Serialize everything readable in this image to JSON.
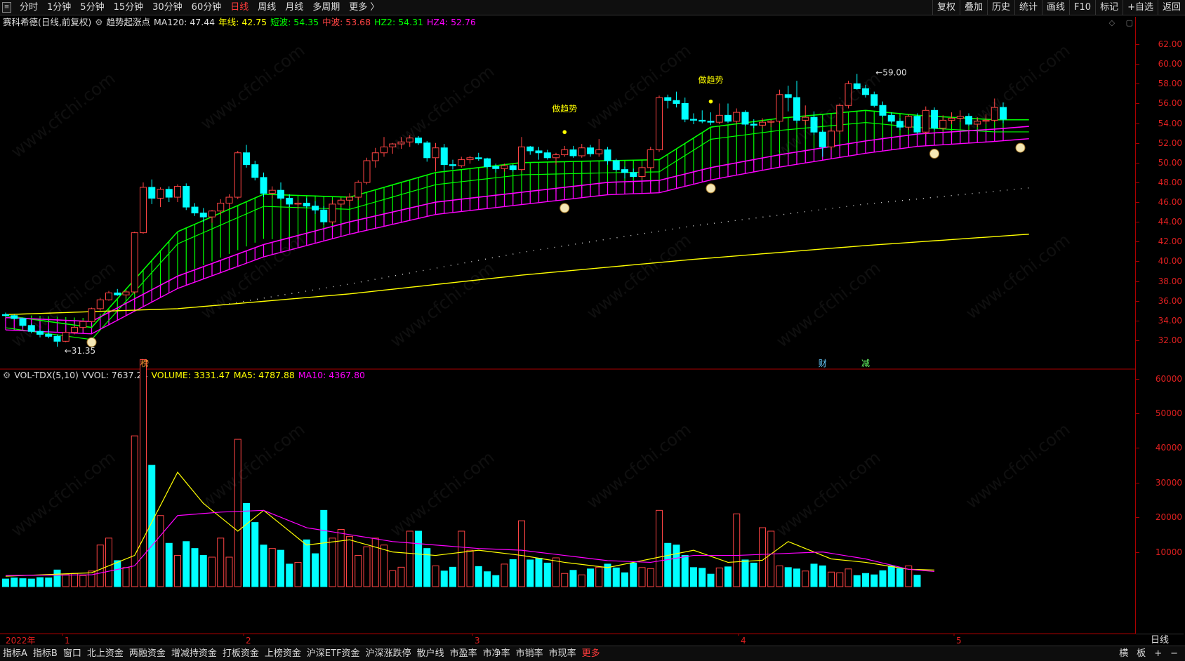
{
  "top_toolbar": {
    "left_items": [
      "分时",
      "1分钟",
      "5分钟",
      "15分钟",
      "30分钟",
      "60分钟",
      "日线",
      "周线",
      "月线",
      "多周期",
      "更多 〉"
    ],
    "active": "日线",
    "right_items": [
      "复权",
      "叠加",
      "历史",
      "统计",
      "画线",
      "F10",
      "标记",
      "+自选",
      "返回"
    ]
  },
  "main_info": {
    "title": "赛科希德(日线,前复权)",
    "indicator": "趋势起涨点",
    "ma120": "MA120: 47.44",
    "nianxian": "年线: 42.75",
    "duanbo": "短波: 54.35",
    "zhongbo": "中波: 53.68",
    "hz2": "HZ2: 54.31",
    "hz4": "HZ4: 52.76"
  },
  "vol_info": {
    "title": "VOL-TDX(5,10)",
    "vvol": "VVOL: 7637.24",
    "volume": "VOLUME: 3331.47",
    "ma5": "MA5: 4787.88",
    "ma10": "MA10: 4367.80"
  },
  "annotations": {
    "low": "←31.35",
    "high": "←59.00",
    "signal1": "做趋势",
    "signal2": "做趋势",
    "tag_bang": "榜",
    "tag_cai": "财",
    "tag_jian": "减"
  },
  "dates": [
    "2022年",
    "1",
    "2",
    "3",
    "4",
    "5"
  ],
  "period_label": "日线",
  "bottom_tabs": [
    "指标A",
    "指标B",
    "窗口",
    "北上资金",
    "两融资金",
    "增减持资金",
    "打板资金",
    "上榜资金",
    "沪深ETF资金",
    "沪深涨跌停",
    "散户线",
    "市盈率",
    "市净率",
    "市销率",
    "市现率",
    "更多"
  ],
  "bottom_right": [
    "横",
    "板",
    "+",
    "−"
  ],
  "colors": {
    "up": "#ff4444",
    "down": "#00ffff",
    "green_band": "#00ff00",
    "magenta_band": "#ff00ff",
    "yellow_line": "#ffff00",
    "axis": "#e02020"
  },
  "watermark": "www.cfchi.com",
  "chart_data": [
    {
      "type": "candlestick",
      "title": "赛科希德(日线,前复权)",
      "ylim": [
        30.5,
        63.5
      ],
      "yticks": [
        32.0,
        34.0,
        36.0,
        38.0,
        40.0,
        42.0,
        44.0,
        46.0,
        48.0,
        50.0,
        52.0,
        54.0,
        56.0,
        58.0,
        60.0,
        62.0
      ],
      "ohlc": [
        [
          34.6,
          34.8,
          34.4,
          34.5
        ],
        [
          34.5,
          34.6,
          34.1,
          34.2
        ],
        [
          34.2,
          34.3,
          33.3,
          33.5
        ],
        [
          33.5,
          33.7,
          32.7,
          32.9
        ],
        [
          32.9,
          33.1,
          32.3,
          32.6
        ],
        [
          32.6,
          33.1,
          32.2,
          32.4
        ],
        [
          32.4,
          32.6,
          31.35,
          31.9
        ],
        [
          31.9,
          33.0,
          31.8,
          32.8
        ],
        [
          32.8,
          33.5,
          32.6,
          33.3
        ],
        [
          33.3,
          34.0,
          33.0,
          33.9
        ],
        [
          33.9,
          35.3,
          33.8,
          35.2
        ],
        [
          35.2,
          36.3,
          35.0,
          36.1
        ],
        [
          36.1,
          37.0,
          36.0,
          36.8
        ],
        [
          36.8,
          37.2,
          36.5,
          36.6
        ],
        [
          36.6,
          37.1,
          36.3,
          36.9
        ],
        [
          36.9,
          43.0,
          36.7,
          42.9
        ],
        [
          42.9,
          48.0,
          42.8,
          47.5
        ],
        [
          47.5,
          48.3,
          45.8,
          46.4
        ],
        [
          46.4,
          47.5,
          45.5,
          47.3
        ],
        [
          47.3,
          47.6,
          46.0,
          46.5
        ],
        [
          46.5,
          47.8,
          46.0,
          47.6
        ],
        [
          47.6,
          47.9,
          45.2,
          45.5
        ],
        [
          45.5,
          45.9,
          44.6,
          44.9
        ],
        [
          44.9,
          45.4,
          44.0,
          44.5
        ],
        [
          44.5,
          45.2,
          43.9,
          45.1
        ],
        [
          45.1,
          46.3,
          44.7,
          45.9
        ],
        [
          45.9,
          46.8,
          45.3,
          46.5
        ],
        [
          46.5,
          51.2,
          46.3,
          51.0
        ],
        [
          51.0,
          51.8,
          49.5,
          49.8
        ],
        [
          49.8,
          50.2,
          48.2,
          48.5
        ],
        [
          48.5,
          49.0,
          46.5,
          46.9
        ],
        [
          46.9,
          47.6,
          46.4,
          47.2
        ],
        [
          47.2,
          48.0,
          46.2,
          46.4
        ],
        [
          46.4,
          46.8,
          45.5,
          45.8
        ],
        [
          45.8,
          46.2,
          45.3,
          45.9
        ],
        [
          45.9,
          46.4,
          45.4,
          45.6
        ],
        [
          45.6,
          46.1,
          44.8,
          45.2
        ],
        [
          45.2,
          45.6,
          43.7,
          44.0
        ],
        [
          44.0,
          46.2,
          43.8,
          45.8
        ],
        [
          45.8,
          46.4,
          45.5,
          46.2
        ],
        [
          46.2,
          46.9,
          45.6,
          46.5
        ],
        [
          46.5,
          48.2,
          46.2,
          48.0
        ],
        [
          48.0,
          50.5,
          47.8,
          50.2
        ],
        [
          50.2,
          51.5,
          49.5,
          51.0
        ],
        [
          51.0,
          52.6,
          50.6,
          51.6
        ],
        [
          51.6,
          52.0,
          50.9,
          51.9
        ],
        [
          51.9,
          52.6,
          51.4,
          52.1
        ],
        [
          52.1,
          52.8,
          51.6,
          52.5
        ],
        [
          52.5,
          52.7,
          51.8,
          52.0
        ],
        [
          52.0,
          52.2,
          50.1,
          50.5
        ],
        [
          50.5,
          52.0,
          49.1,
          51.5
        ],
        [
          51.5,
          51.9,
          49.2,
          49.8
        ],
        [
          49.8,
          50.3,
          49.3,
          49.7
        ],
        [
          49.7,
          50.6,
          49.5,
          50.3
        ],
        [
          50.3,
          50.7,
          49.9,
          50.5
        ],
        [
          50.5,
          51.0,
          50.2,
          50.4
        ],
        [
          50.4,
          50.5,
          49.4,
          49.6
        ],
        [
          49.6,
          49.9,
          49.0,
          49.4
        ],
        [
          49.4,
          49.9,
          49.1,
          49.7
        ],
        [
          49.7,
          49.8,
          49.1,
          49.3
        ],
        [
          49.3,
          52.6,
          49.1,
          51.6
        ],
        [
          51.6,
          51.7,
          50.8,
          51.2
        ],
        [
          51.2,
          51.6,
          50.3,
          51.0
        ],
        [
          51.0,
          51.3,
          50.3,
          50.5
        ],
        [
          50.5,
          51.0,
          49.8,
          50.8
        ],
        [
          50.8,
          51.7,
          50.6,
          51.3
        ],
        [
          51.3,
          51.7,
          50.5,
          50.7
        ],
        [
          50.7,
          51.9,
          50.5,
          51.5
        ],
        [
          51.5,
          51.8,
          50.6,
          50.9
        ],
        [
          50.9,
          52.4,
          50.6,
          51.3
        ],
        [
          51.3,
          51.6,
          49.8,
          50.2
        ],
        [
          50.2,
          50.4,
          49.1,
          49.3
        ],
        [
          49.3,
          49.6,
          48.4,
          49.0
        ],
        [
          49.0,
          49.4,
          48.5,
          48.6
        ],
        [
          48.6,
          49.7,
          48.3,
          49.5
        ],
        [
          49.5,
          51.6,
          49.3,
          51.3
        ],
        [
          51.3,
          56.8,
          51.1,
          56.6
        ],
        [
          56.6,
          56.9,
          55.5,
          56.3
        ],
        [
          56.3,
          57.2,
          55.6,
          56.0
        ],
        [
          56.0,
          56.6,
          54.1,
          54.4
        ],
        [
          54.4,
          55.0,
          53.9,
          54.3
        ],
        [
          54.3,
          55.3,
          54.0,
          54.2
        ],
        [
          54.2,
          55.1,
          53.8,
          54.1
        ],
        [
          54.1,
          56.0,
          53.9,
          54.8
        ],
        [
          54.8,
          56.0,
          54.0,
          54.2
        ],
        [
          54.2,
          55.5,
          53.9,
          55.1
        ],
        [
          55.1,
          55.3,
          53.7,
          53.9
        ],
        [
          53.9,
          54.4,
          53.5,
          53.8
        ],
        [
          53.8,
          54.5,
          53.5,
          54.1
        ],
        [
          54.1,
          54.3,
          53.6,
          54.2
        ],
        [
          54.2,
          57.4,
          54.0,
          56.9
        ],
        [
          56.9,
          57.8,
          55.2,
          56.6
        ],
        [
          56.6,
          58.3,
          54.0,
          54.3
        ],
        [
          54.3,
          55.8,
          53.8,
          54.6
        ],
        [
          54.6,
          55.2,
          52.8,
          53.1
        ],
        [
          53.1,
          53.3,
          50.6,
          51.6
        ],
        [
          51.6,
          53.5,
          51.3,
          53.2
        ],
        [
          53.2,
          56.0,
          52.9,
          55.8
        ],
        [
          55.8,
          58.3,
          55.5,
          58.0
        ],
        [
          58.0,
          59.0,
          57.4,
          57.5
        ],
        [
          57.5,
          57.9,
          56.6,
          56.9
        ],
        [
          56.9,
          57.2,
          55.6,
          55.8
        ],
        [
          55.8,
          56.2,
          54.6,
          54.8
        ],
        [
          54.8,
          55.1,
          54.0,
          54.2
        ],
        [
          54.2,
          54.5,
          53.3,
          53.6
        ],
        [
          53.6,
          54.9,
          53.3,
          54.7
        ],
        [
          54.7,
          55.0,
          52.9,
          53.1
        ],
        [
          53.1,
          55.7,
          52.8,
          55.3
        ],
        [
          55.3,
          55.6,
          53.3,
          53.5
        ],
        [
          53.5,
          54.8,
          53.2,
          54.3
        ],
        [
          54.3,
          55.1,
          53.9,
          54.5
        ],
        [
          54.5,
          55.3,
          54.1,
          54.7
        ],
        [
          54.7,
          55.0,
          53.7,
          53.9
        ],
        [
          53.9,
          54.6,
          53.6,
          54.2
        ],
        [
          54.2,
          54.9,
          53.9,
          54.3
        ],
        [
          54.3,
          56.5,
          54.1,
          55.6
        ],
        [
          55.6,
          56.1,
          54.0,
          54.4
        ]
      ],
      "series": [
        {
          "name": "短波",
          "points": [
            [
              0,
              34.5
            ],
            [
              10,
              33.3
            ],
            [
              20,
              43.0
            ],
            [
              30,
              46.8
            ],
            [
              40,
              46.5
            ],
            [
              50,
              49.0
            ],
            [
              60,
              50.0
            ],
            [
              70,
              50.2
            ],
            [
              76,
              50.3
            ],
            [
              82,
              53.6
            ],
            [
              90,
              54.5
            ],
            [
              100,
              55.3
            ],
            [
              106,
              54.8
            ],
            [
              115,
              54.35
            ],
            [
              119,
              54.35
            ]
          ]
        },
        {
          "name": "中波",
          "points": [
            [
              0,
              34.3
            ],
            [
              10,
              33.9
            ],
            [
              20,
              38.5
            ],
            [
              30,
              41.7
            ],
            [
              40,
              44.0
            ],
            [
              50,
              46.0
            ],
            [
              60,
              47.0
            ],
            [
              70,
              48.0
            ],
            [
              76,
              48.2
            ],
            [
              82,
              49.5
            ],
            [
              90,
              50.8
            ],
            [
              100,
              52.2
            ],
            [
              106,
              52.9
            ],
            [
              115,
              53.4
            ],
            [
              119,
              53.68
            ]
          ]
        },
        {
          "name": "年线",
          "points": [
            [
              0,
              34.6
            ],
            [
              20,
              35.2
            ],
            [
              40,
              36.7
            ],
            [
              60,
              38.6
            ],
            [
              80,
              40.2
            ],
            [
              100,
              41.6
            ],
            [
              119,
              42.75
            ]
          ]
        },
        {
          "name": "MA120",
          "points": [
            [
              26,
              35.7
            ],
            [
              40,
              37.7
            ],
            [
              60,
              40.9
            ],
            [
              80,
              43.6
            ],
            [
              100,
              45.8
            ],
            [
              119,
              47.44
            ]
          ]
        }
      ]
    },
    {
      "type": "bar",
      "title": "VOL-TDX(5,10)",
      "ylim": [
        0,
        66000
      ],
      "yticks": [
        10000,
        20000,
        30000,
        40000,
        50000,
        60000
      ],
      "volumes": [
        2200,
        2500,
        2300,
        2200,
        2600,
        2500,
        4800,
        3600,
        3800,
        3200,
        4500,
        12000,
        14000,
        7500,
        5500,
        43500,
        65500,
        35000,
        20500,
        12500,
        9000,
        13000,
        11000,
        9000,
        8500,
        14000,
        8500,
        42500,
        24000,
        18500,
        12000,
        11000,
        10500,
        6500,
        7000,
        13500,
        9500,
        22000,
        14000,
        16500,
        14500,
        9000,
        11500,
        14000,
        12000,
        4600,
        5600,
        16000,
        16000,
        11000,
        6000,
        4500,
        5600,
        16000,
        10500,
        5800,
        4300,
        3200,
        6500,
        7800,
        19000,
        7700,
        8200,
        6800,
        8300,
        3800,
        4700,
        3400,
        5100,
        5600,
        6500,
        5400,
        4000,
        6800,
        5500,
        5200,
        22000,
        12500,
        12000,
        9000,
        5500,
        5300,
        3600,
        5400,
        5700,
        21000,
        7700,
        6800,
        17000,
        16000,
        6000,
        5500,
        5100,
        4500,
        6500,
        6000,
        4200,
        4000,
        5100,
        3200,
        3800,
        3400,
        4600,
        6000,
        5200,
        6000,
        3300
      ],
      "series": [
        {
          "name": "MA5",
          "points": [
            [
              0,
              3000
            ],
            [
              10,
              4000
            ],
            [
              15,
              9000
            ],
            [
              20,
              33000
            ],
            [
              23,
              24000
            ],
            [
              27,
              16000
            ],
            [
              30,
              22000
            ],
            [
              35,
              12000
            ],
            [
              40,
              13500
            ],
            [
              45,
              10000
            ],
            [
              50,
              9000
            ],
            [
              55,
              10500
            ],
            [
              60,
              9000
            ],
            [
              65,
              7000
            ],
            [
              70,
              5500
            ],
            [
              75,
              8000
            ],
            [
              80,
              10500
            ],
            [
              84,
              7000
            ],
            [
              88,
              7600
            ],
            [
              91,
              13000
            ],
            [
              96,
              8000
            ],
            [
              100,
              7000
            ],
            [
              105,
              5000
            ],
            [
              108,
              4787.88
            ]
          ]
        },
        {
          "name": "MA10",
          "points": [
            [
              0,
              3200
            ],
            [
              10,
              3400
            ],
            [
              15,
              6000
            ],
            [
              20,
              20500
            ],
            [
              25,
              21500
            ],
            [
              30,
              22000
            ],
            [
              35,
              17000
            ],
            [
              40,
              15000
            ],
            [
              45,
              13000
            ],
            [
              50,
              12000
            ],
            [
              55,
              11000
            ],
            [
              60,
              10500
            ],
            [
              65,
              9000
            ],
            [
              70,
              7500
            ],
            [
              75,
              7000
            ],
            [
              80,
              9000
            ],
            [
              85,
              9000
            ],
            [
              90,
              9500
            ],
            [
              95,
              10000
            ],
            [
              100,
              8000
            ],
            [
              105,
              5000
            ],
            [
              108,
              4367.8
            ]
          ]
        }
      ]
    }
  ]
}
